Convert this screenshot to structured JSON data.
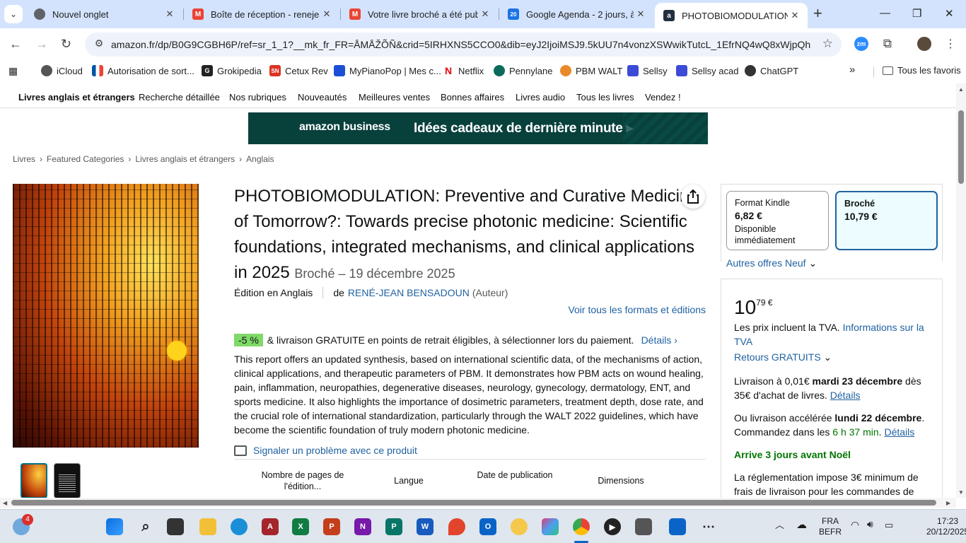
{
  "tabs": [
    {
      "title": "Nouvel onglet",
      "icon": "chrome-icon",
      "color": "#5f6368"
    },
    {
      "title": "Boîte de réception - renejean",
      "icon": "gmail-icon",
      "color": "#ea4335"
    },
    {
      "title": "Votre livre broché a été publi",
      "icon": "gmail-icon",
      "color": "#ea4335"
    },
    {
      "title": "Google Agenda - 2 jours, à p",
      "icon": "calendar-icon",
      "color": "#1a73e8"
    },
    {
      "title": "PHOTOBIOMODULATION: P",
      "icon": "amazon-icon",
      "color": "#232f3e"
    }
  ],
  "calendar_badge": "20",
  "address": {
    "url": "amazon.fr/dp/B0G9CGBH6P/ref=sr_1_1?__mk_fr_FR=ÅMÅŽÕÑ&crid=5IRHXNS5CCO0&dib=eyJ2IjoiMSJ9.5kUU7n4vonzXSWwikTutcL_1EfrNQ4wQ8xWjpQh3PE..."
  },
  "ext_badge": "zm",
  "bookmarks": [
    {
      "label": "iCloud",
      "icon": "apple-icon"
    },
    {
      "label": "Autorisation de sort...",
      "icon": "flag-icon"
    },
    {
      "label": "Grokipedia",
      "icon": "grok-icon"
    },
    {
      "label": "Cetux Rev",
      "icon": "sn-icon"
    },
    {
      "label": "MyPianoPop | Mes c...",
      "icon": "piano-icon"
    },
    {
      "label": "Netflix",
      "icon": "netflix-icon"
    },
    {
      "label": "Pennylane",
      "icon": "pennylane-icon"
    },
    {
      "label": "PBM WALT",
      "icon": "pbm-icon"
    },
    {
      "label": "Sellsy",
      "icon": "sellsy-icon"
    },
    {
      "label": "Sellsy acad",
      "icon": "sellsy-icon"
    },
    {
      "label": "ChatGPT",
      "icon": "chatgpt-icon"
    }
  ],
  "bookmarks_more": "»",
  "all_bookmarks": "Tous les favoris",
  "subnav": [
    "Livres anglais et étrangers",
    "Recherche détaillée",
    "Nos rubriques",
    "Nouveautés",
    "Meilleures ventes",
    "Bonnes affaires",
    "Livres audio",
    "Tous les livres",
    "Vendez !"
  ],
  "banner": {
    "brand": "amazon business",
    "text": "Idées cadeaux de dernière minute ▸"
  },
  "breadcrumb": [
    "Livres",
    "Featured Categories",
    "Livres anglais et étrangers",
    "Anglais"
  ],
  "product": {
    "title": "PHOTOBIOMODULATION: Preventive and Curative Medicine of Tomorrow?: Towards precise photonic medicine: Scientific foundations, integrated mechanisms, and clinical applications in 2025",
    "meta": "Broché – 19 décembre 2025",
    "edition": "Édition en Anglais",
    "by": "de",
    "author": "RENÉ-JEAN BENSADOUN",
    "role": "(Auteur)",
    "all_formats": "Voir tous les formats et éditions",
    "discount": "-5 %",
    "promo": "& livraison GRATUITE en points de retrait éligibles, à sélectionner lors du paiement.",
    "promo_link": "Détails ›",
    "description": "This report offers an updated synthesis, based on international scientific data, of the mechanisms of action, clinical applications, and therapeutic parameters of PBM. It demonstrates how PBM acts on wound healing, pain, inflammation, neuropathies, degenerative diseases, neurology, gynecology, dermatology, ENT, and sports medicine. It also highlights the importance of dosimetric parameters, treatment depth, dose rate, and the crucial role of international standardization, particularly through the WALT 2022 guidelines, which have become the scientific foundation of truly modern photonic medicine.",
    "report": "Signaler un problème avec ce produit",
    "specs": [
      "Nombre de pages de l'édition...",
      "Langue",
      "Date de publication",
      "Dimensions"
    ]
  },
  "formats": [
    {
      "name": "Format Kindle",
      "price": "6,82 €",
      "avail": "Disponible immédiatement",
      "selected": false
    },
    {
      "name": "Broché",
      "price": "10,79 €",
      "avail": "",
      "selected": true
    }
  ],
  "other_offers": "Autres offres Neuf",
  "buybox": {
    "price_int": "10",
    "price_dec": "79 €",
    "vat": "Les prix incluent la TVA.",
    "vat_link": "Informations sur la TVA",
    "returns": "Retours GRATUITS",
    "delivery_a": "Livraison à 0,01€",
    "delivery_date": "mardi 23 décembre",
    "delivery_b": "dès 35€ d'achat de livres.",
    "delivery_link": "Détails",
    "fast_a": "Ou livraison accélérée",
    "fast_date": "lundi 22 décembre",
    "fast_b": "Commandez dans les",
    "fast_time": "6 h 37 min",
    "fast_link": "Détails",
    "christmas": "Arrive 3 jours avant Noël",
    "regulation": "La réglementation impose 3€ minimum de frais de livraison pour les commandes de"
  },
  "taskbar": {
    "weather_badge": "4",
    "lang_1": "FRA",
    "lang_2": "BEFR",
    "time": "17:23",
    "date": "20/12/2025"
  }
}
